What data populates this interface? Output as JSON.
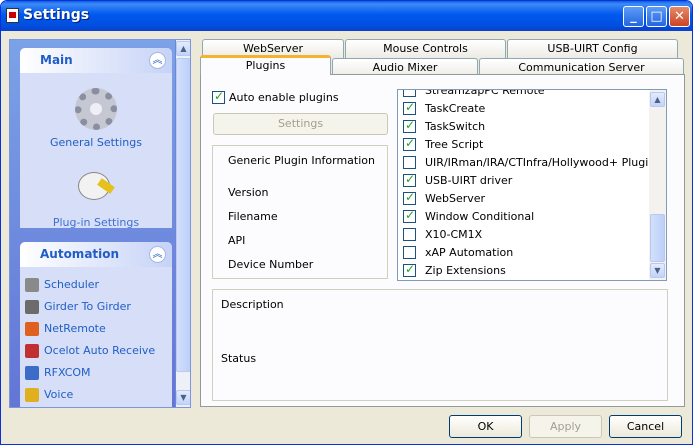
{
  "window": {
    "title": "Settings"
  },
  "titlebar_buttons": {
    "minimize": "_",
    "maximize": "□",
    "close": "✕"
  },
  "sidebar": {
    "main_group": {
      "title": "Main",
      "items": [
        {
          "label": "General Settings",
          "icon": "gear-icon"
        },
        {
          "label": "Plug-in Settings",
          "icon": "plug-icon"
        }
      ]
    },
    "automation_group": {
      "title": "Automation",
      "items": [
        {
          "label": "Scheduler",
          "icon": "scheduler-icon",
          "color": "#8a8a8a"
        },
        {
          "label": "Girder To Girder",
          "icon": "girder-icon",
          "color": "#6b6b6b"
        },
        {
          "label": "NetRemote",
          "icon": "netremote-icon",
          "color": "#e06020"
        },
        {
          "label": "Ocelot Auto Receive",
          "icon": "ocelot-icon",
          "color": "#c03030"
        },
        {
          "label": "RFXCOM",
          "icon": "rfxcom-icon",
          "color": "#3a6cc8"
        },
        {
          "label": "Voice",
          "icon": "voice-icon",
          "color": "#e0b020"
        }
      ]
    }
  },
  "tabs": {
    "row1": [
      "WebServer",
      "Mouse Controls",
      "USB-UIRT Config"
    ],
    "row2": [
      "Plugins",
      "Audio Mixer",
      "Communication Server"
    ],
    "active": "Plugins"
  },
  "plugins_tab": {
    "auto_enable_label": "Auto enable plugins",
    "auto_enable_checked": true,
    "settings_button": "Settings",
    "info": {
      "heading": "Generic Plugin Information",
      "fields": [
        "Version",
        "Filename",
        "API",
        "Device Number"
      ]
    },
    "plugin_list": [
      {
        "name": "StreamzapPC Remote",
        "checked": false
      },
      {
        "name": "TaskCreate",
        "checked": true
      },
      {
        "name": "TaskSwitch",
        "checked": true
      },
      {
        "name": "Tree Script",
        "checked": true
      },
      {
        "name": "UIR/IRman/IRA/CTInfra/Hollywood+ Plugin",
        "checked": false
      },
      {
        "name": "USB-UIRT driver",
        "checked": true
      },
      {
        "name": "WebServer",
        "checked": true
      },
      {
        "name": "Window Conditional",
        "checked": true
      },
      {
        "name": "X10-CM1X",
        "checked": false
      },
      {
        "name": "xAP Automation",
        "checked": false
      },
      {
        "name": "Zip Extensions",
        "checked": true
      }
    ],
    "description_label": "Description",
    "status_label": "Status"
  },
  "footer": {
    "ok": "OK",
    "apply": "Apply",
    "cancel": "Cancel"
  }
}
